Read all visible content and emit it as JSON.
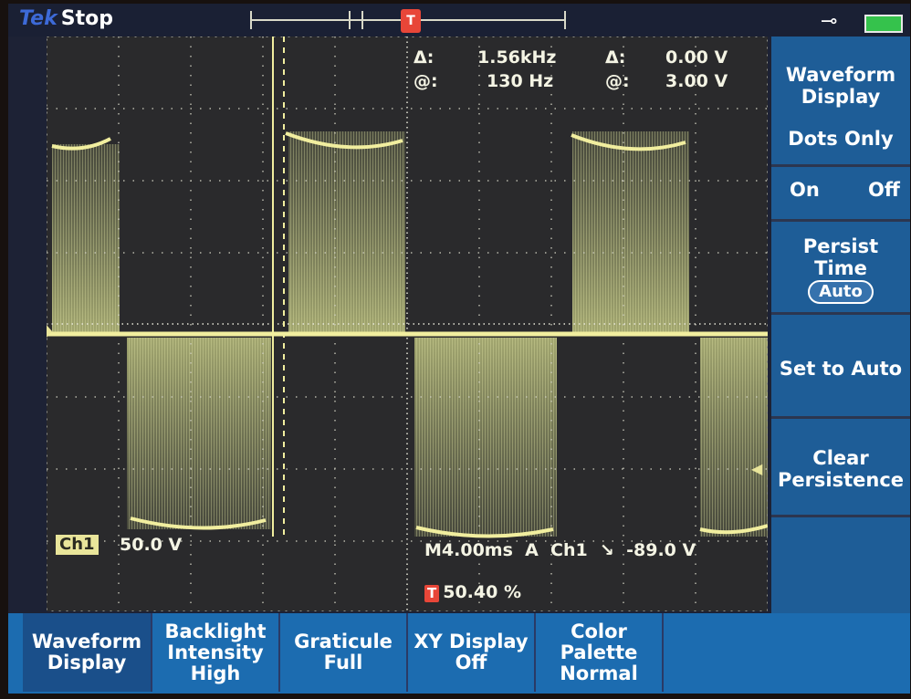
{
  "topbar": {
    "brand": "Tek",
    "status": "Stop",
    "trigger_marker_label": "T",
    "power_icon": "power-plug-icon",
    "battery_icon": "battery-icon"
  },
  "cursor_readout": {
    "delta_label_1": "Δ:",
    "delta_value_1": "1.56kHz",
    "at_label_1": "@:",
    "at_value_1": "130 Hz",
    "delta_label_2": "Δ:",
    "delta_value_2": "0.00 V",
    "at_label_2": "@:",
    "at_value_2": "3.00 V"
  },
  "channel": {
    "marker": "1",
    "tag": "Ch1",
    "scale": "50.0 V"
  },
  "timebase": {
    "text": "M4.00ms  A  Ch1  ↘  -89.0 V",
    "trigger_position": "50.40 %"
  },
  "side_menu": {
    "title_line1": "Waveform",
    "title_line2": "Display",
    "dots_only": "Dots Only",
    "on": "On",
    "off": "Off",
    "persist_line1": "Persist",
    "persist_line2": "Time",
    "persist_value": "Auto",
    "set_to_auto": "Set to Auto",
    "clear_line1": "Clear",
    "clear_line2": "Persistence"
  },
  "bottom_menu": [
    {
      "line1": "Waveform",
      "line2": "Display",
      "line3": ""
    },
    {
      "line1": "Backlight",
      "line2": "Intensity",
      "line3": "High"
    },
    {
      "line1": "Graticule",
      "line2": "Full",
      "line3": ""
    },
    {
      "line1": "XY Display",
      "line2": "Off",
      "line3": ""
    },
    {
      "line1": "Color",
      "line2": "Palette",
      "line3": "Normal"
    }
  ],
  "colors": {
    "trace": "#e9e59a",
    "menu_blue": "#1e5d97",
    "trigger_red": "#e84638"
  }
}
